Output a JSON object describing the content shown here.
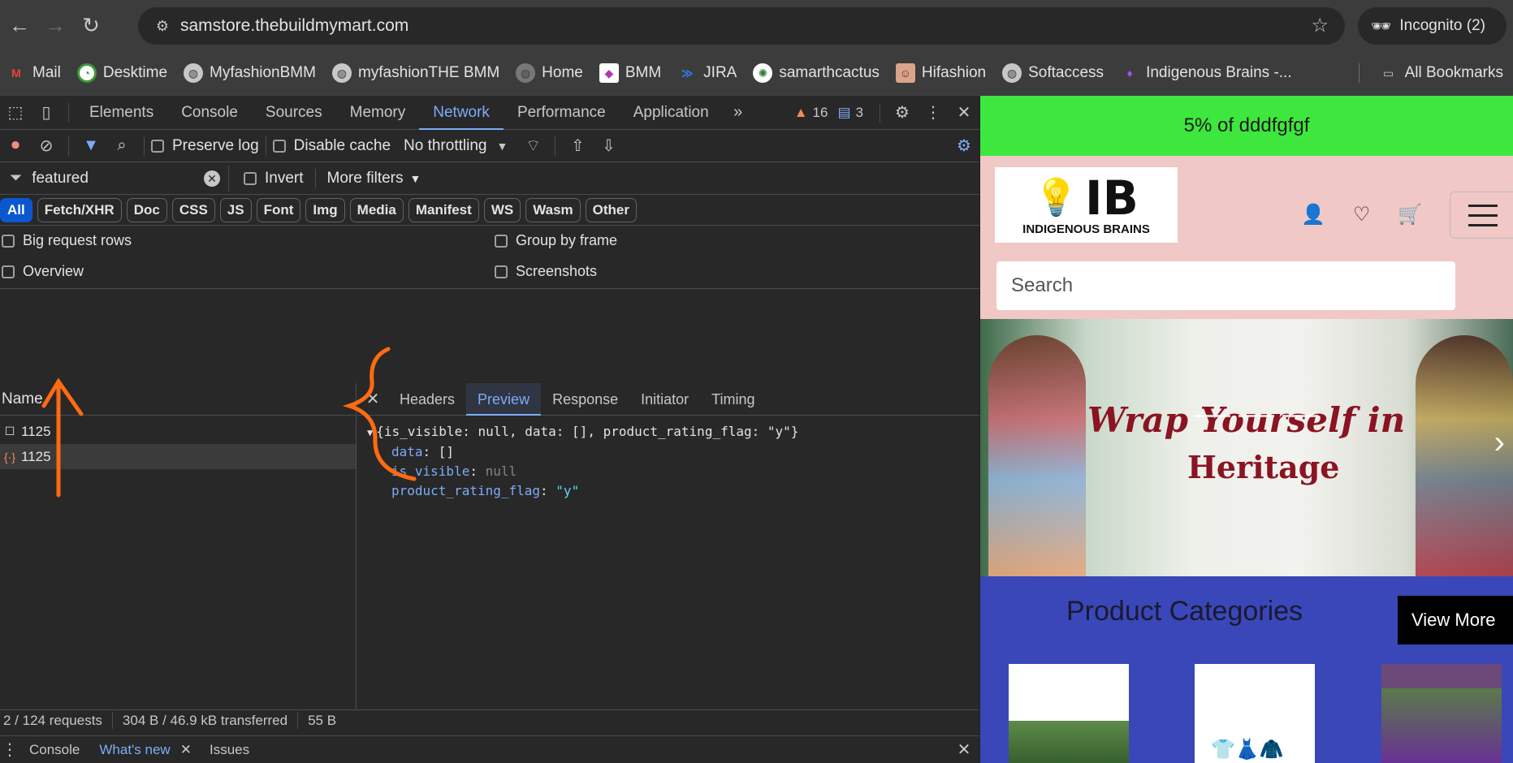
{
  "browser": {
    "url": "samstore.thebuildmymart.com",
    "incognito_label": "Incognito (2)",
    "bookmarks": [
      {
        "label": "Mail",
        "icon": "gmail-icon"
      },
      {
        "label": "Desktime",
        "icon": "desktime-icon"
      },
      {
        "label": "MyfashionBMM",
        "icon": "globe-icon"
      },
      {
        "label": "myfashionTHE BMM",
        "icon": "globe-icon"
      },
      {
        "label": "Home",
        "icon": "globe-icon"
      },
      {
        "label": "BMM",
        "icon": "bmm-icon"
      },
      {
        "label": "JIRA",
        "icon": "jira-icon"
      },
      {
        "label": "samarthcactus",
        "icon": "cactus-icon"
      },
      {
        "label": "Hifashion",
        "icon": "hifashion-icon"
      },
      {
        "label": "Softaccess",
        "icon": "globe-icon"
      },
      {
        "label": "Indigenous Brains -...",
        "icon": "ib-icon"
      }
    ],
    "all_bookmarks": "All Bookmarks"
  },
  "devtools": {
    "tabs": [
      "Elements",
      "Console",
      "Sources",
      "Memory",
      "Network",
      "Performance",
      "Application"
    ],
    "active_tab": "Network",
    "warnings": "16",
    "messages": "3",
    "toolbar": {
      "preserve_log": "Preserve log",
      "disable_cache": "Disable cache",
      "throttling": "No throttling"
    },
    "filter": {
      "value": "featured",
      "invert": "Invert",
      "more_filters": "More filters"
    },
    "types": [
      "All",
      "Fetch/XHR",
      "Doc",
      "CSS",
      "JS",
      "Font",
      "Img",
      "Media",
      "Manifest",
      "WS",
      "Wasm",
      "Other"
    ],
    "options": {
      "big_rows": "Big request rows",
      "group_by_frame": "Group by frame",
      "overview": "Overview",
      "screenshots": "Screenshots"
    },
    "requests_header": "Name",
    "requests": [
      {
        "name": "1125",
        "icon": "document-icon"
      },
      {
        "name": "1125",
        "icon": "json-icon"
      }
    ],
    "detail_tabs": [
      "Headers",
      "Preview",
      "Response",
      "Initiator",
      "Timing"
    ],
    "preview": {
      "summary": "{is_visible: null, data: [], product_rating_flag: \"y\"}",
      "data_key": "data",
      "data_val": "[]",
      "visible_key": "is_visible",
      "visible_val": "null",
      "flag_key": "product_rating_flag",
      "flag_val": "\"y\""
    },
    "status": {
      "requests": "2 / 124 requests",
      "transferred": "304 B / 46.9 kB transferred",
      "resources": "55 B"
    },
    "drawer": [
      "Console",
      "What's new",
      "Issues"
    ]
  },
  "site": {
    "promo": "5% of dddfgfgf",
    "logo_text": "IB",
    "logo_sub": "INDIGENOUS BRAINS",
    "search_placeholder": "Search",
    "hero_line1": "Wrap Yourself in",
    "hero_line2": "Heritage",
    "categories_title": "Product Categories",
    "view_more": "View More"
  }
}
